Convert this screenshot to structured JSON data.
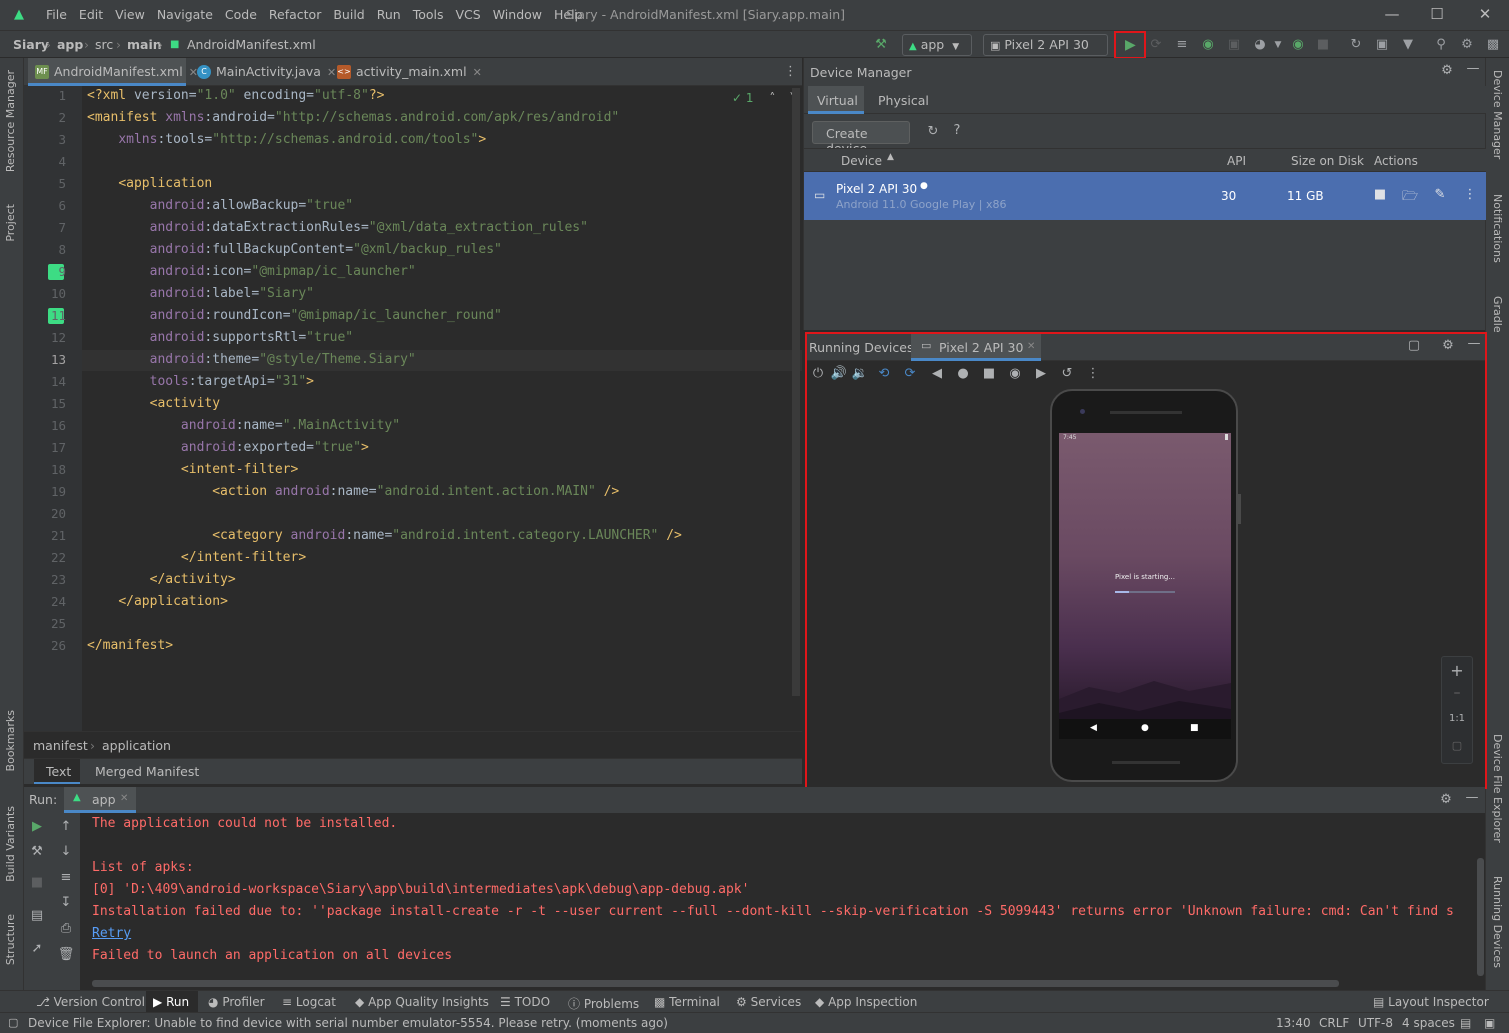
{
  "menu": [
    "File",
    "Edit",
    "View",
    "Navigate",
    "Code",
    "Refactor",
    "Build",
    "Run",
    "Tools",
    "VCS",
    "Window",
    "Help"
  ],
  "window_title": "Siary - AndroidManifest.xml [Siary.app.main]",
  "breadcrumb": {
    "project": "Siary",
    "module": "app",
    "src": "src",
    "main": "main",
    "file": "AndroidManifest.xml"
  },
  "toolbar": {
    "config": "app",
    "device": "Pixel 2 API 30"
  },
  "editor_tabs": [
    {
      "label": "AndroidManifest.xml",
      "type": "xml"
    },
    {
      "label": "MainActivity.java",
      "type": "java"
    },
    {
      "label": "activity_main.xml",
      "type": "layout"
    }
  ],
  "inspection_count": "1",
  "code_lines": [
    "<?xml version=\"1.0\" encoding=\"utf-8\"?>",
    "<manifest xmlns:android=\"http://schemas.android.com/apk/res/android\"",
    "    xmlns:tools=\"http://schemas.android.com/tools\">",
    "",
    "    <application",
    "        android:allowBackup=\"true\"",
    "        android:dataExtractionRules=\"@xml/data_extraction_rules\"",
    "        android:fullBackupContent=\"@xml/backup_rules\"",
    "        android:icon=\"@mipmap/ic_launcher\"",
    "        android:label=\"Siary\"",
    "        android:roundIcon=\"@mipmap/ic_launcher_round\"",
    "        android:supportsRtl=\"true\"",
    "        android:theme=\"@style/Theme.Siary\"",
    "        tools:targetApi=\"31\">",
    "        <activity",
    "            android:name=\".MainActivity\"",
    "            android:exported=\"true\">",
    "            <intent-filter>",
    "                <action android:name=\"android.intent.action.MAIN\" />",
    "",
    "                <category android:name=\"android.intent.category.LAUNCHER\" />",
    "            </intent-filter>",
    "        </activity>",
    "    </application>",
    "",
    "</manifest>"
  ],
  "editor_crumbs": [
    "manifest",
    "application"
  ],
  "editor_bottom_tabs": [
    "Text",
    "Merged Manifest"
  ],
  "device_manager": {
    "title": "Device Manager",
    "tabs": [
      "Virtual",
      "Physical"
    ],
    "create_button": "Create device",
    "help": "?",
    "columns": [
      "Device",
      "API",
      "Size on Disk",
      "Actions"
    ],
    "device": {
      "name": "Pixel 2 API 30",
      "sub": "Android 11.0 Google Play | x86",
      "api": "30",
      "size": "11 GB"
    }
  },
  "running_devices": {
    "title": "Running Devices:",
    "tab": "Pixel 2 API 30",
    "phone_time": "7:45",
    "boot_text": "Pixel is starting...",
    "zoom_ratio": "1:1"
  },
  "run": {
    "label": "Run:",
    "tab": "app",
    "lines": [
      "The application could not be installed.",
      "",
      "List of apks:",
      "[0] 'D:\\409\\android-workspace\\Siary\\app\\build\\intermediates\\apk\\debug\\app-debug.apk'",
      "Installation failed due to: ''package install-create -r -t --user current --full --dont-kill --skip-verification -S 5099443' returns error 'Unknown failure: cmd: Can't find s"
    ],
    "retry": "Retry",
    "final_line": "Failed to launch an application on all devices"
  },
  "bottom_tools": [
    "Version Control",
    "Run",
    "Profiler",
    "Logcat",
    "App Quality Insights",
    "TODO",
    "Problems",
    "Terminal",
    "Services",
    "App Inspection"
  ],
  "layout_inspector": "Layout Inspector",
  "status": {
    "message": "Device File Explorer: Unable to find device with serial number emulator-5554. Please retry. (moments ago)",
    "position": "13:40",
    "line_sep": "CRLF",
    "encoding": "UTF-8",
    "indent": "4 spaces"
  },
  "left_stripe": [
    "Resource Manager",
    "Project",
    "Bookmarks",
    "Build Variants",
    "Structure"
  ],
  "right_stripe": [
    "Device Manager",
    "Notifications",
    "Gradle",
    "Device File Explorer",
    "Running Devices"
  ],
  "colors": {
    "accent": "#4a88c7",
    "highlight_red": "#e0161a",
    "error": "#ff6b68",
    "run_green": "#59a869"
  }
}
